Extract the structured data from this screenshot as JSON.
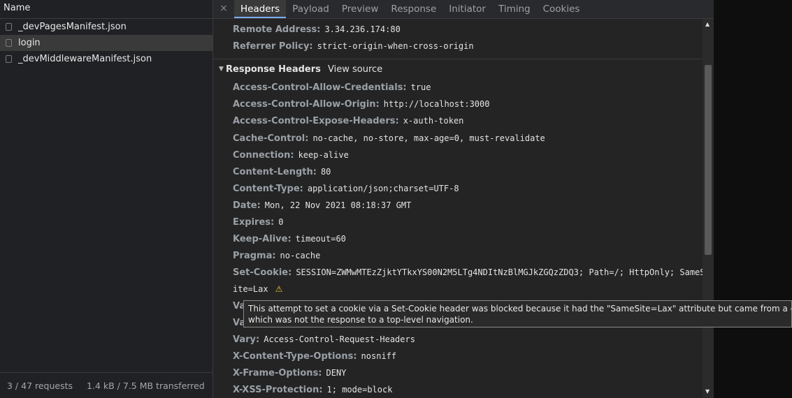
{
  "requests": {
    "column_header": "Name",
    "items": [
      {
        "name": "_devPagesManifest.json"
      },
      {
        "name": "login",
        "selected": true
      },
      {
        "name": "_devMiddlewareManifest.json"
      }
    ]
  },
  "status_bar": {
    "requests": "3 / 47 requests",
    "transferred": "1.4 kB / 7.5 MB transferred",
    "truncated": "3."
  },
  "tabs": {
    "close": "×",
    "items": [
      "Headers",
      "Payload",
      "Preview",
      "Response",
      "Initiator",
      "Timing",
      "Cookies"
    ],
    "active": "Headers"
  },
  "general": [
    {
      "key": "Remote Address:",
      "value": "3.34.236.174:80"
    },
    {
      "key": "Referrer Policy:",
      "value": "strict-origin-when-cross-origin"
    }
  ],
  "response_headers": {
    "title": "Response Headers",
    "view_source": "View source",
    "items": [
      {
        "key": "Access-Control-Allow-Credentials:",
        "value": "true"
      },
      {
        "key": "Access-Control-Allow-Origin:",
        "value": "http://localhost:3000"
      },
      {
        "key": "Access-Control-Expose-Headers:",
        "value": "x-auth-token"
      },
      {
        "key": "Cache-Control:",
        "value": "no-cache, no-store, max-age=0, must-revalidate"
      },
      {
        "key": "Connection:",
        "value": "keep-alive"
      },
      {
        "key": "Content-Length:",
        "value": "80"
      },
      {
        "key": "Content-Type:",
        "value": "application/json;charset=UTF-8"
      },
      {
        "key": "Date:",
        "value": "Mon, 22 Nov 2021 08:18:37 GMT"
      },
      {
        "key": "Expires:",
        "value": "0"
      },
      {
        "key": "Keep-Alive:",
        "value": "timeout=60"
      },
      {
        "key": "Pragma:",
        "value": "no-cache"
      },
      {
        "key": "Set-Cookie:",
        "value": "SESSION=ZWMwMTEzZjktYTkxYS00N2M5LTg4NDItNzBlMGJkZGQzZDQ3; Path=/; HttpOnly; SameS",
        "value_cont": "ite=Lax"
      },
      {
        "key": "Va",
        "value": ""
      },
      {
        "key": "Va",
        "value": ""
      },
      {
        "key": "Vary:",
        "value": "Access-Control-Request-Headers"
      },
      {
        "key": "X-Content-Type-Options:",
        "value": "nosniff"
      },
      {
        "key": "X-Frame-Options:",
        "value": "DENY"
      },
      {
        "key": "X-XSS-Protection:",
        "value": "1; mode=block"
      }
    ]
  },
  "tooltip": {
    "line1": "This attempt to set a cookie via a Set-Cookie header was blocked because it had the \"SameSite=Lax\" attribute but came from a cross-site response",
    "line2": "which was not the response to a top-level navigation."
  },
  "icons": {
    "warning": "warning-icon",
    "scroll_up": "scroll-up-arrow",
    "scroll_down": "scroll-down-arrow",
    "triangle": "collapse-triangle-icon"
  },
  "colors": {
    "accent": "#7cacf8",
    "warning": "#f2c236"
  }
}
